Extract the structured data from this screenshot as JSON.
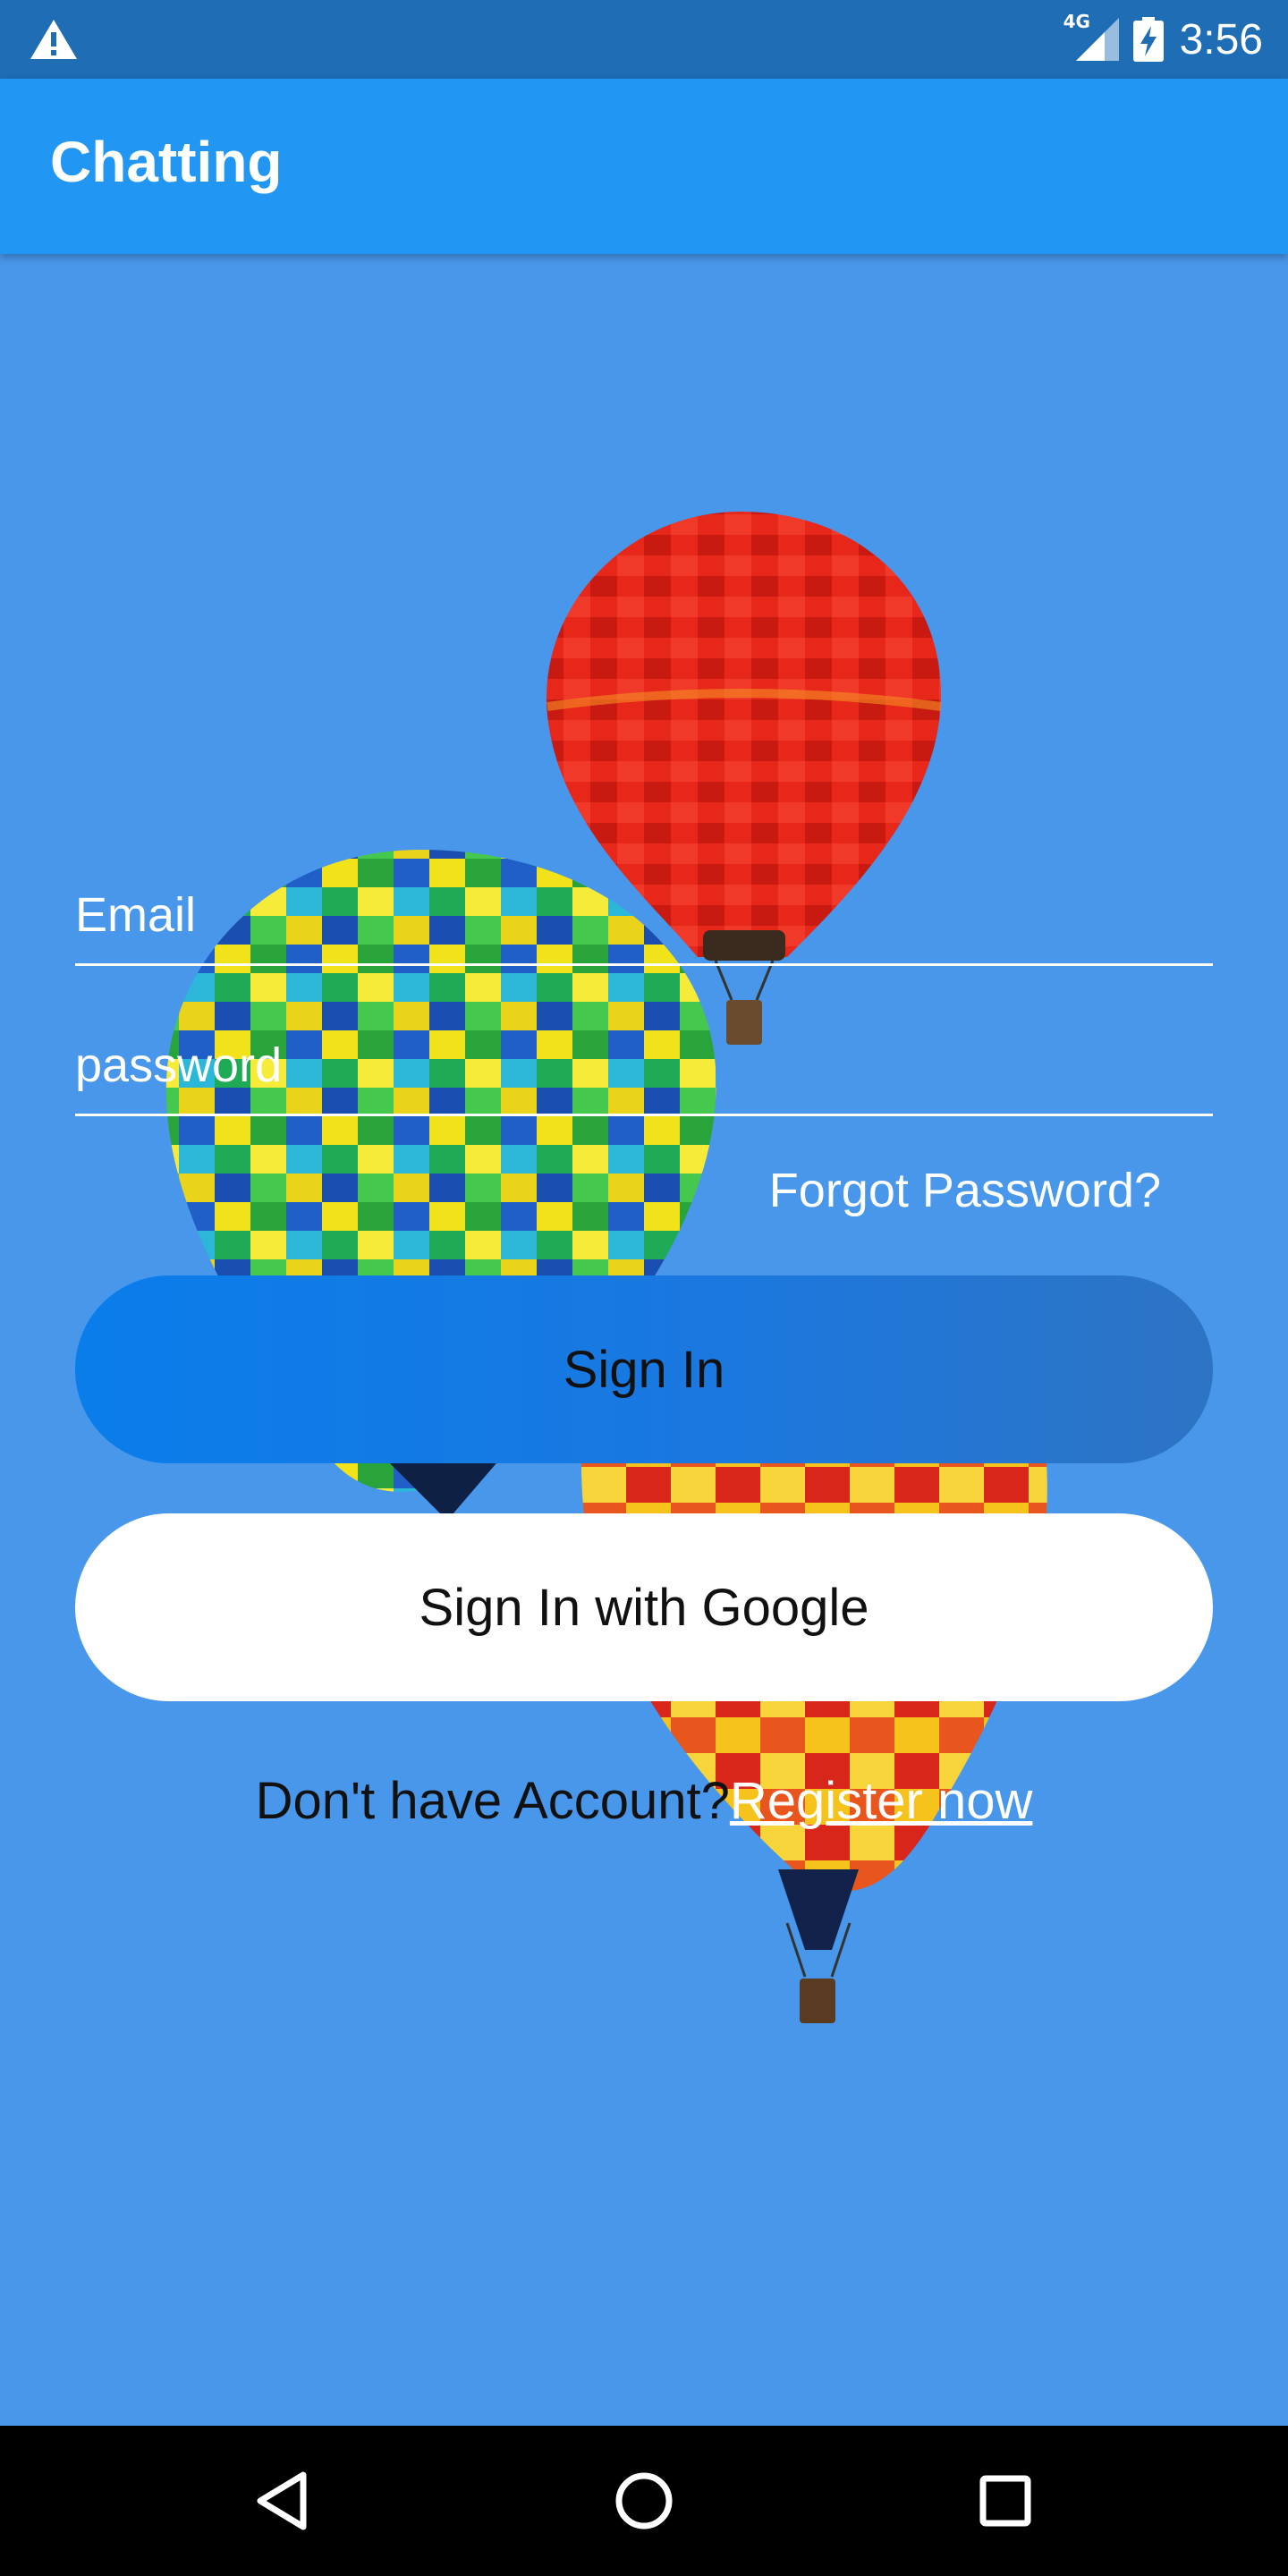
{
  "status_bar": {
    "time": "3:56",
    "network": "4G",
    "icons": [
      "warning-icon",
      "signal-icon",
      "battery-charging-icon"
    ]
  },
  "app_bar": {
    "title": "Chatting"
  },
  "form": {
    "email_placeholder": "Email",
    "password_placeholder": "password",
    "forgot_label": "Forgot Password?",
    "signin_label": "Sign In",
    "google_label": "Sign In with Google",
    "register_prompt": "Don't have Account?",
    "register_link": "Register now"
  },
  "nav_bar": {
    "icons": [
      "back-icon",
      "home-icon",
      "recents-icon"
    ]
  },
  "colors": {
    "background": "#4897EA",
    "app_bar": "#2196F3",
    "status_bar": "#1E6DB5",
    "signin_button": "#0A7DEB"
  }
}
